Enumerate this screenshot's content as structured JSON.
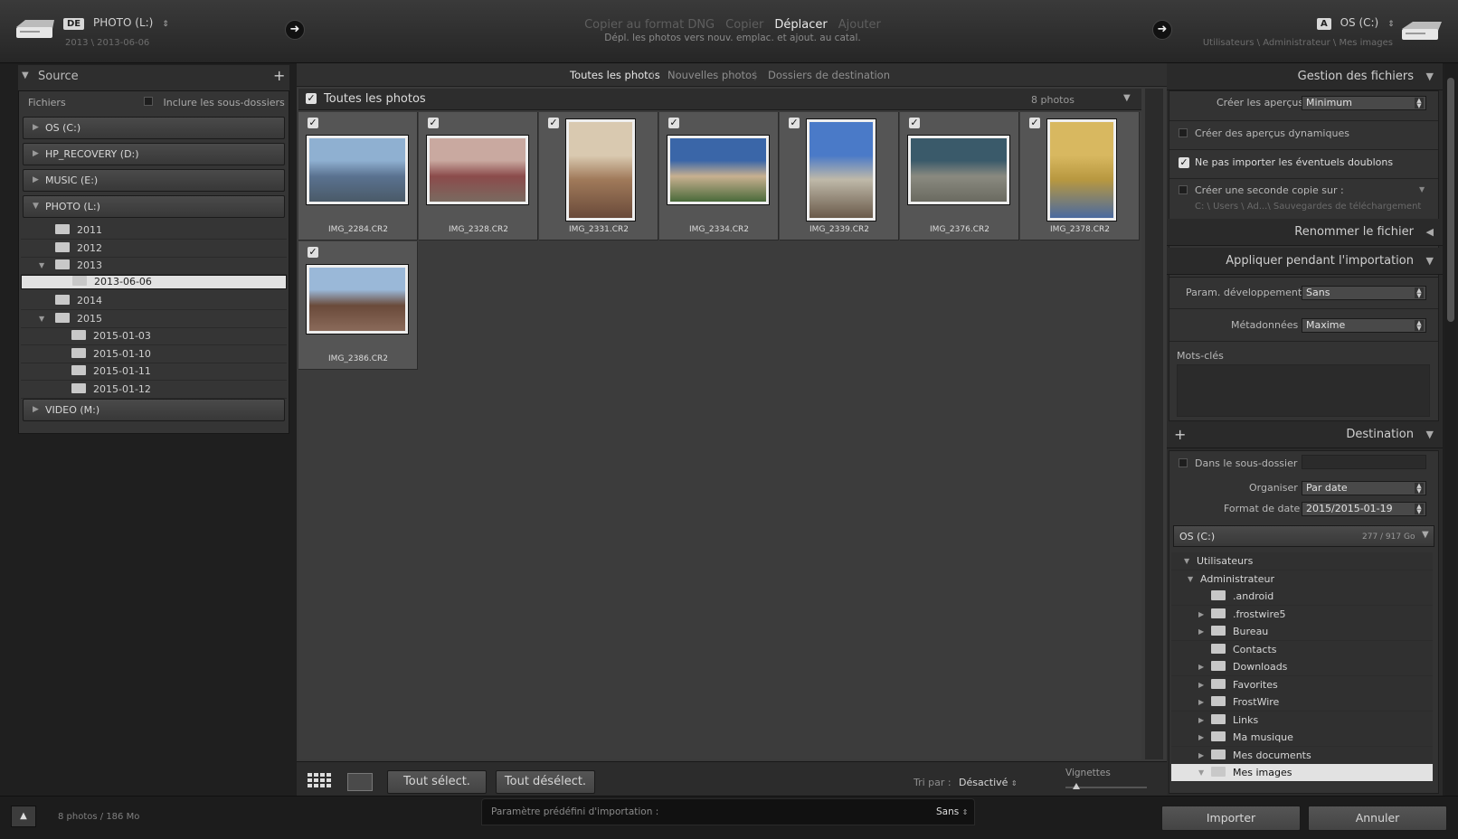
{
  "topbar": {
    "source_badge": "DE",
    "source_drive": "PHOTO (L:)",
    "source_path": "2013 \\ 2013-06-06",
    "modes": [
      {
        "label": "Copier au format DNG",
        "active": false
      },
      {
        "label": "Copier",
        "active": false
      },
      {
        "label": "Déplacer",
        "active": true
      },
      {
        "label": "Ajouter",
        "active": false
      }
    ],
    "mode_description": "Dépl. les photos vers nouv. emplac. et ajout. au catal.",
    "dest_badge": "A",
    "dest_drive": "OS (C:)",
    "dest_path": "Utilisateurs \\ Administrateur \\ Mes images"
  },
  "source": {
    "title": "Source",
    "files_label": "Fichiers",
    "include_subfolders": "Inclure les sous-dossiers",
    "drives": [
      "OS (C:)",
      "HP_RECOVERY (D:)",
      "MUSIC (E:)",
      "PHOTO (L:)",
      "VIDEO (M:)"
    ],
    "folders": [
      {
        "name": "2011",
        "depth": 1,
        "expand": ""
      },
      {
        "name": "2012",
        "depth": 1,
        "expand": ""
      },
      {
        "name": "2013",
        "depth": 1,
        "expand": "open"
      },
      {
        "name": "2013-06-06",
        "depth": 2,
        "expand": "",
        "selected": true
      },
      {
        "name": "2014",
        "depth": 1,
        "expand": ""
      },
      {
        "name": "2015",
        "depth": 1,
        "expand": "open"
      },
      {
        "name": "2015-01-03",
        "depth": 2,
        "expand": ""
      },
      {
        "name": "2015-01-10",
        "depth": 2,
        "expand": ""
      },
      {
        "name": "2015-01-11",
        "depth": 2,
        "expand": ""
      },
      {
        "name": "2015-01-12",
        "depth": 2,
        "expand": ""
      }
    ]
  },
  "center": {
    "tabs": [
      {
        "label": "Toutes les photos",
        "active": true
      },
      {
        "label": "Nouvelles photos",
        "active": false
      },
      {
        "label": "Dossiers de destination",
        "active": false
      }
    ],
    "header_label": "Toutes les photos",
    "count": "8 photos",
    "photos": [
      {
        "name": "IMG_2284.CR2",
        "orient": "land",
        "colors": [
          "#8fb0d1",
          "#5a7290",
          "#4a5a68"
        ]
      },
      {
        "name": "IMG_2328.CR2",
        "orient": "land",
        "colors": [
          "#c9a9a0",
          "#8b4b4b",
          "#7a6a60"
        ]
      },
      {
        "name": "IMG_2331.CR2",
        "orient": "port",
        "colors": [
          "#d9c9b0",
          "#a07a5a",
          "#6a4a3a"
        ]
      },
      {
        "name": "IMG_2334.CR2",
        "orient": "land",
        "colors": [
          "#3a66a8",
          "#c8b090",
          "#4a6a3a"
        ]
      },
      {
        "name": "IMG_2339.CR2",
        "orient": "port",
        "colors": [
          "#4a7ac8",
          "#bfb9a9",
          "#6a5a4a"
        ]
      },
      {
        "name": "IMG_2376.CR2",
        "orient": "land",
        "colors": [
          "#3a5a6a",
          "#8a8a80",
          "#6a6a60"
        ]
      },
      {
        "name": "IMG_2378.CR2",
        "orient": "port",
        "colors": [
          "#d8b860",
          "#b89840",
          "#4a6aa0"
        ]
      },
      {
        "name": "IMG_2386.CR2",
        "orient": "land",
        "colors": [
          "#9ab8d8",
          "#6a4a3a",
          "#8a6a5a"
        ]
      }
    ],
    "select_all": "Tout sélect.",
    "deselect_all": "Tout désélect.",
    "sort_label": "Tri par :",
    "sort_value": "Désactivé",
    "thumbs_label": "Vignettes"
  },
  "right": {
    "file_handling": "Gestion des fichiers",
    "create_previews_label": "Créer les aperçus",
    "create_previews_value": "Minimum",
    "smart_previews": "Créer des aperçus dynamiques",
    "no_duplicates": "Ne pas importer les éventuels doublons",
    "second_copy": "Créer une seconde copie sur :",
    "second_copy_path": "C: \\ Users \\ Ad...\\ Sauvegardes de téléchargement",
    "rename": "Renommer le fichier",
    "apply": "Appliquer pendant l'importation",
    "dev_label": "Param. développement",
    "dev_value": "Sans",
    "meta_label": "Métadonnées",
    "meta_value": "Maxime",
    "keywords_label": "Mots-clés",
    "destination": "Destination",
    "subfolder": "Dans le sous-dossier",
    "organize_label": "Organiser",
    "organize_value": "Par date",
    "date_label": "Format de date",
    "date_value": "2015/2015-01-19",
    "drive": "OS (C:)",
    "drive_space": "277 / 917 Go",
    "tree": [
      {
        "name": "Utilisateurs",
        "depth": 0,
        "expand": "open",
        "folder": false
      },
      {
        "name": "Administrateur",
        "depth": 1,
        "expand": "open",
        "folder": false
      },
      {
        "name": ".android",
        "depth": 2,
        "expand": "",
        "folder": true
      },
      {
        "name": ".frostwire5",
        "depth": 2,
        "expand": "closed",
        "folder": true
      },
      {
        "name": "Bureau",
        "depth": 2,
        "expand": "closed",
        "folder": true
      },
      {
        "name": "Contacts",
        "depth": 2,
        "expand": "",
        "folder": true
      },
      {
        "name": "Downloads",
        "depth": 2,
        "expand": "closed",
        "folder": true
      },
      {
        "name": "Favorites",
        "depth": 2,
        "expand": "closed",
        "folder": true
      },
      {
        "name": "FrostWire",
        "depth": 2,
        "expand": "closed",
        "folder": true
      },
      {
        "name": "Links",
        "depth": 2,
        "expand": "closed",
        "folder": true
      },
      {
        "name": "Ma musique",
        "depth": 2,
        "expand": "closed",
        "folder": true
      },
      {
        "name": "Mes documents",
        "depth": 2,
        "expand": "closed",
        "folder": true
      },
      {
        "name": "Mes images",
        "depth": 2,
        "expand": "open",
        "folder": true,
        "selected": true
      }
    ]
  },
  "bottom": {
    "status": "8 photos / 186 Mo",
    "preset_label": "Paramètre prédéfini d'importation :",
    "preset_value": "Sans",
    "import": "Importer",
    "cancel": "Annuler"
  }
}
